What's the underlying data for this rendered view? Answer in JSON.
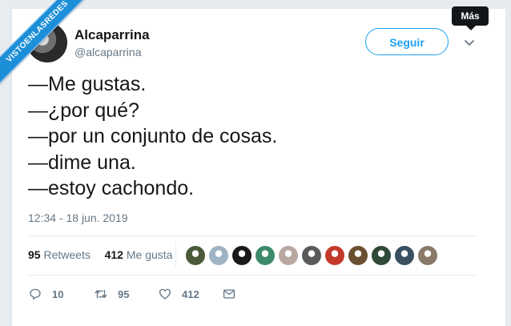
{
  "watermark": "VISTOENLASREDES",
  "user": {
    "name": "Alcaparrina",
    "handle": "@alcaparrina"
  },
  "follow_label": "Seguir",
  "tooltip": "Más",
  "tweet_lines": [
    "—Me gustas.",
    "—¿por qué?",
    "—por un conjunto de cosas.",
    "—dime una.",
    "—estoy cachondo."
  ],
  "timestamp": "12:34 - 18 jun. 2019",
  "stats": {
    "retweets_count": "95",
    "retweets_label": "Retweets",
    "likes_count": "412",
    "likes_label": "Me gusta"
  },
  "liker_avatar_colors": [
    "#4a5a3a",
    "#9fb3c4",
    "#1a1a1a",
    "#3d8a6a",
    "#b8a8a0",
    "#5a5a5a",
    "#c43a2a",
    "#6a5030",
    "#2f4a38",
    "#3a5060",
    "#8a7a6a"
  ],
  "actions": {
    "reply_count": "10",
    "retweet_count": "95",
    "like_count": "412"
  },
  "colors": {
    "accent": "#1da1f2",
    "text": "#14171a",
    "secondary": "#657786",
    "ribbon": "#1d8fd8"
  }
}
